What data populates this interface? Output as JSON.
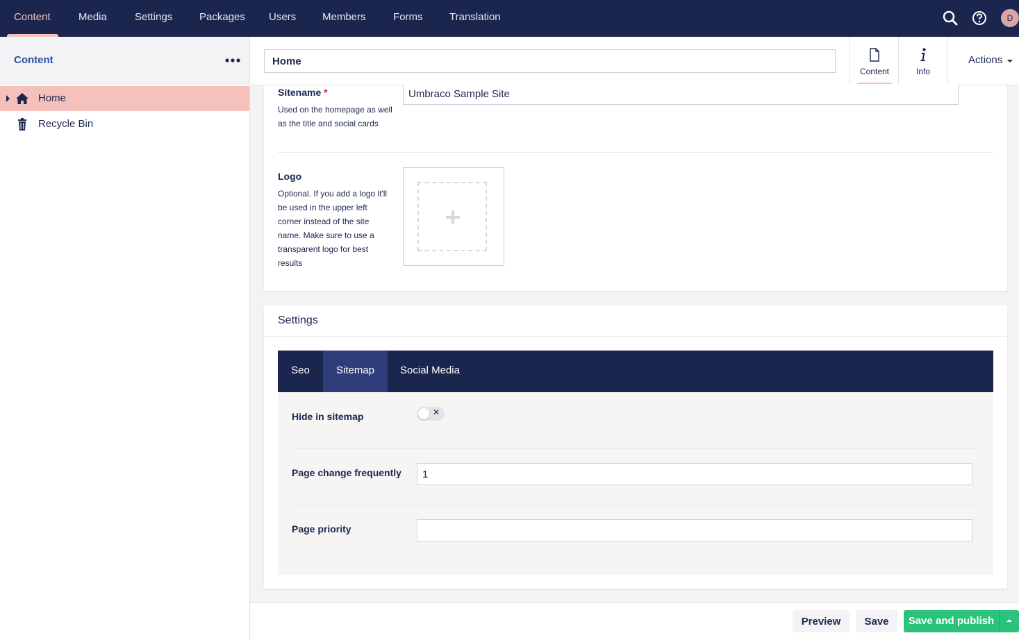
{
  "nav": {
    "items": [
      {
        "label": "Content",
        "active": true
      },
      {
        "label": "Media"
      },
      {
        "label": "Settings"
      },
      {
        "label": "Packages"
      },
      {
        "label": "Users"
      },
      {
        "label": "Members"
      },
      {
        "label": "Forms"
      },
      {
        "label": "Translation"
      }
    ],
    "icons": [
      "search-icon",
      "help-icon"
    ],
    "avatar_initial": "D"
  },
  "sidebar": {
    "title": "Content",
    "menu_icon": "more-dots-icon",
    "tree": [
      {
        "label": "Home",
        "icon": "home-icon",
        "selected": true
      },
      {
        "label": "Recycle Bin",
        "icon": "trash-icon"
      }
    ]
  },
  "editor": {
    "name_value": "Home",
    "apps": [
      {
        "label": "Content",
        "icon": "document-icon",
        "active": true
      },
      {
        "label": "Info",
        "icon": "info-icon"
      }
    ],
    "actions_label": "Actions"
  },
  "content_panel": {
    "sitename": {
      "label": "Sitename",
      "required_mark": "*",
      "description": "Used on the homepage as well as the title and social cards",
      "value": "Umbraco Sample Site"
    },
    "logo": {
      "label": "Logo",
      "description": "Optional. If you add a logo it'll be used in the upper left corner instead of the site name. Make sure to use a transparent logo for best results",
      "picker_icon": "plus-icon"
    }
  },
  "settings_panel": {
    "title": "Settings",
    "tabs": [
      {
        "label": "Seo"
      },
      {
        "label": "Sitemap",
        "active": true
      },
      {
        "label": "Social Media"
      }
    ],
    "fields": {
      "hide_in_sitemap": {
        "label": "Hide in sitemap",
        "toggle_mark": "✕",
        "checked": false
      },
      "page_change_frequently": {
        "label": "Page change frequently",
        "value": "1"
      },
      "page_priority": {
        "label": "Page priority",
        "value": ""
      }
    }
  },
  "footer": {
    "preview_label": "Preview",
    "save_label": "Save",
    "save_publish_label": "Save and publish"
  },
  "colors": {
    "nav_bg": "#1b264f",
    "accent_pink": "#f5c1bc",
    "publish_green": "#2bc37c"
  }
}
